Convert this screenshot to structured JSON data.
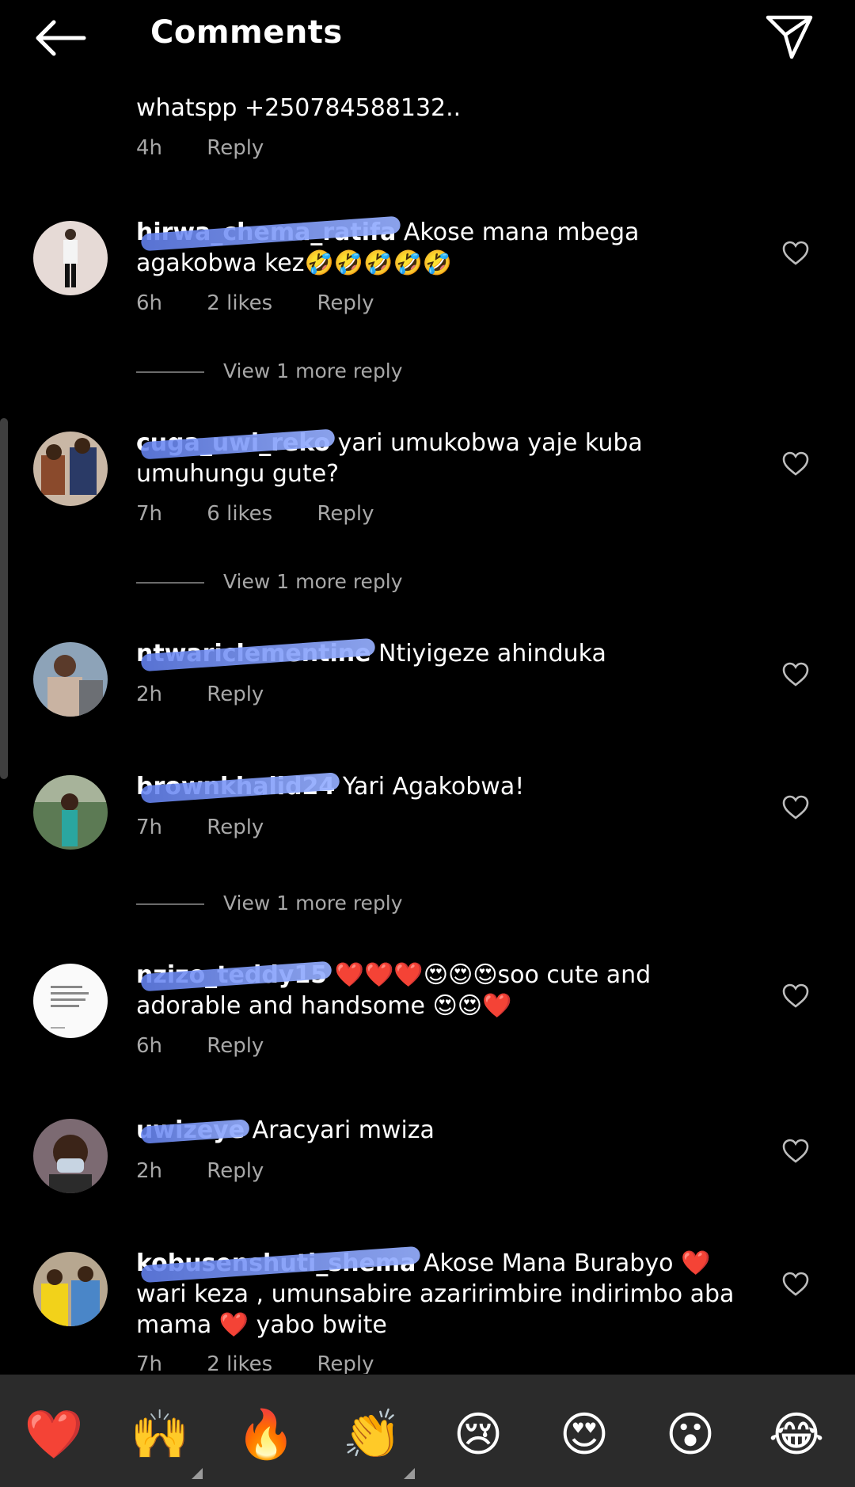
{
  "header": {
    "title": "Comments",
    "back_icon": "arrow-left-icon",
    "send_icon": "paper-plane-icon"
  },
  "partial_comment": {
    "text": "whatspp +250784588132..",
    "time": "4h",
    "reply_label": "Reply"
  },
  "comments": [
    {
      "username": "hirwa_chema_ratifa",
      "text": "Akose mana mbega agakobwa kez🤣🤣🤣🤣🤣",
      "time": "6h",
      "likes": "2 likes",
      "reply_label": "Reply",
      "view_more": "View 1 more reply"
    },
    {
      "username": "cuga_uwi_reko",
      "text": "yari umukobwa yaje kuba umuhungu gute?",
      "time": "7h",
      "likes": "6 likes",
      "reply_label": "Reply",
      "view_more": "View 1 more reply"
    },
    {
      "username": "ntwariclementine",
      "text": "Ntiyigeze ahinduka",
      "time": "2h",
      "likes": "",
      "reply_label": "Reply",
      "view_more": ""
    },
    {
      "username": "brownkhalid24",
      "text": "Yari Agakobwa!",
      "time": "7h",
      "likes": "",
      "reply_label": "Reply",
      "view_more": "View 1 more reply"
    },
    {
      "username": "nzizo_teddy15",
      "text": "❤️❤️❤️😍😍😍soo cute and adorable and handsome 😍😍❤️",
      "time": "6h",
      "likes": "",
      "reply_label": "Reply",
      "view_more": ""
    },
    {
      "username": "uwizeye",
      "text": "Aracyari mwiza",
      "time": "2h",
      "likes": "",
      "reply_label": "Reply",
      "view_more": ""
    },
    {
      "username": "kobusenshuti_shema",
      "text": "Akose Mana Burabyo ❤️ wari keza , umunsabire azaririmbire indirimbo aba mama ❤️ yabo bwite",
      "time": "7h",
      "likes": "2 likes",
      "reply_label": "Reply",
      "view_more": ""
    }
  ],
  "emoji_bar": [
    "❤️",
    "🙌",
    "🔥",
    "👏",
    "😢",
    "😍",
    "😮",
    "😂"
  ],
  "colors": {
    "background": "#000000",
    "secondary_text": "#a8a8a8",
    "emoji_bar_bg": "#2b2b2b",
    "redaction": "#7d9cf5"
  }
}
